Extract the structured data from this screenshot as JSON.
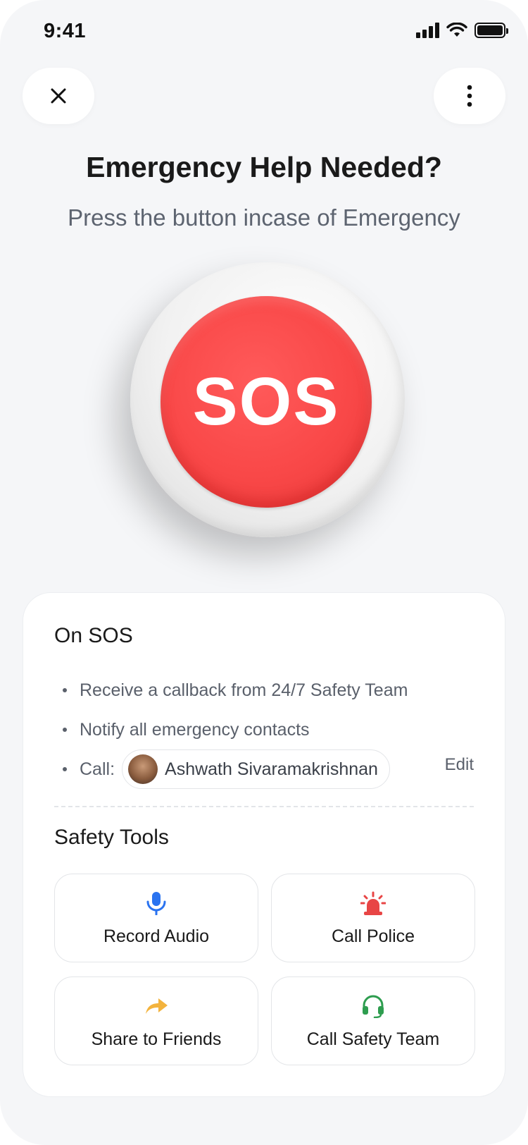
{
  "status_bar": {
    "time": "9:41"
  },
  "header": {
    "title": "Emergency Help Needed?",
    "subtitle": "Press the button incase of Emergency"
  },
  "sos_button": {
    "label": "SOS",
    "color": "#f94848"
  },
  "on_sos": {
    "heading": "On SOS",
    "items": [
      "Receive a callback from 24/7 Safety Team",
      "Notify all emergency contacts"
    ],
    "call_label": "Call:",
    "contact_name": "Ashwath Sivaramakrishnan",
    "edit_label": "Edit"
  },
  "safety_tools": {
    "heading": "Safety Tools",
    "tools": [
      {
        "label": "Record Audio",
        "icon": "microphone-icon",
        "color": "#2a73f0"
      },
      {
        "label": "Call Police",
        "icon": "siren-icon",
        "color": "#e84545"
      },
      {
        "label": "Share to Friends",
        "icon": "share-arrow-icon",
        "color": "#f3b33d"
      },
      {
        "label": "Call Safety Team",
        "icon": "headset-icon",
        "color": "#2e9d4f"
      }
    ]
  }
}
